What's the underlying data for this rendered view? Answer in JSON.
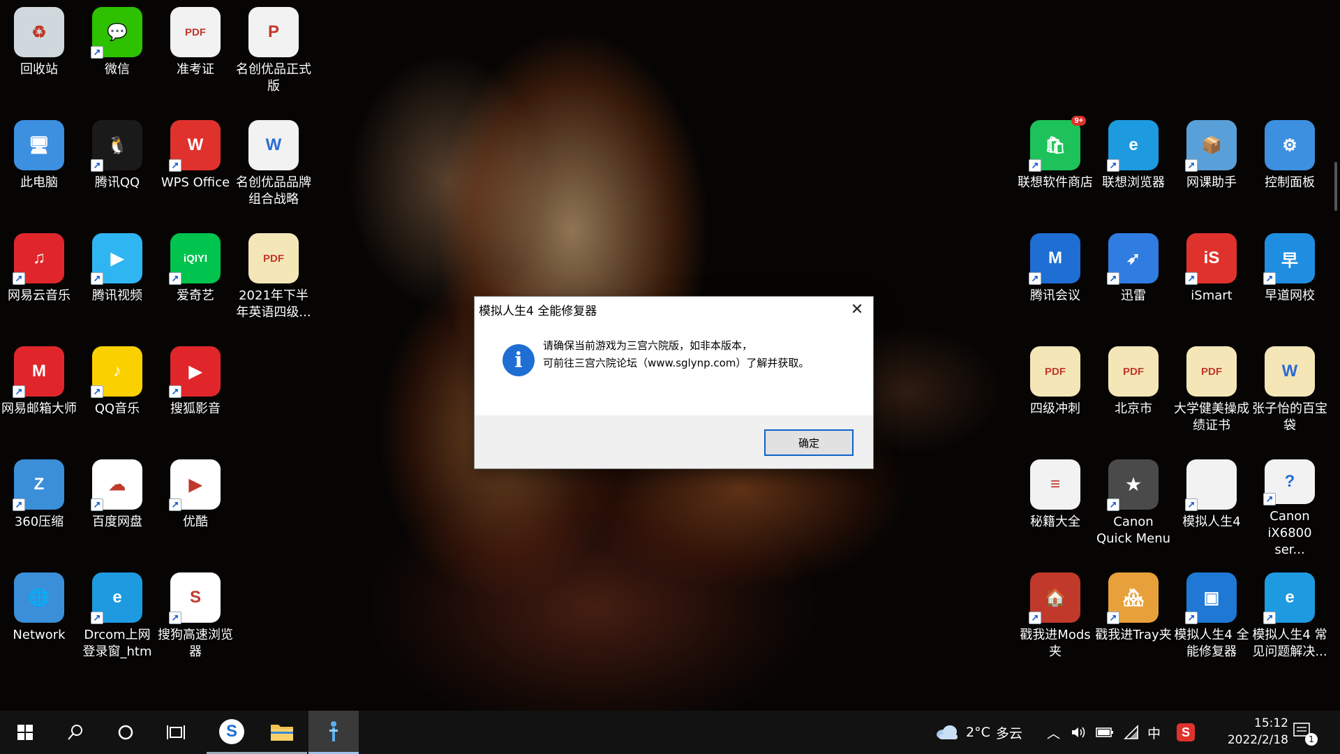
{
  "desktop": {
    "left_icons": [
      {
        "label": "回收站",
        "icon": "recycle-bin-icon",
        "color": "#cfd8dc",
        "glyph": "♻",
        "shortcut": false
      },
      {
        "label": "微信",
        "icon": "wechat-icon",
        "color": "#2dc100",
        "glyph": "💬",
        "shortcut": true
      },
      {
        "label": "准考证",
        "icon": "pdf-file-icon",
        "color": "#f2f2f2",
        "glyph": "PDF",
        "shortcut": false
      },
      {
        "label": "名创优品正式版",
        "icon": "ppt-file-icon",
        "color": "#f2f2f2",
        "glyph": "P",
        "shortcut": false
      },
      {
        "label": "此电脑",
        "icon": "this-pc-icon",
        "color": "#3d8fe0",
        "glyph": "🖥",
        "shortcut": false
      },
      {
        "label": "腾讯QQ",
        "icon": "qq-penguin-icon",
        "color": "#1a1a1a",
        "glyph": "🐧",
        "shortcut": true
      },
      {
        "label": "WPS Office",
        "icon": "wps-office-icon",
        "color": "#e0322d",
        "glyph": "W",
        "shortcut": true
      },
      {
        "label": "名创优品品牌组合战略",
        "icon": "word-file-icon",
        "color": "#f2f2f2",
        "glyph": "W",
        "shortcut": false
      },
      {
        "label": "网易云音乐",
        "icon": "netease-music-icon",
        "color": "#e0262b",
        "glyph": "♫",
        "shortcut": true
      },
      {
        "label": "腾讯视频",
        "icon": "tencent-video-icon",
        "color": "#2fb5f2",
        "glyph": "▶",
        "shortcut": true
      },
      {
        "label": "爱奇艺",
        "icon": "iqiyi-icon",
        "color": "#00c44d",
        "glyph": "iQIYI",
        "shortcut": true
      },
      {
        "label": "2021年下半年英语四级...",
        "icon": "pdf-file-icon",
        "color": "#f5e6b8",
        "glyph": "PDF",
        "shortcut": false
      },
      {
        "label": "网易邮箱大师",
        "icon": "netease-mail-icon",
        "color": "#e0262b",
        "glyph": "M",
        "shortcut": true
      },
      {
        "label": "QQ音乐",
        "icon": "qq-music-icon",
        "color": "#fbd000",
        "glyph": "♪",
        "shortcut": true
      },
      {
        "label": "搜狐影音",
        "icon": "sohu-video-icon",
        "color": "#e0262b",
        "glyph": "▶",
        "shortcut": true
      },
      {
        "label": "",
        "icon": "",
        "color": "",
        "glyph": "",
        "shortcut": false
      },
      {
        "label": "360压缩",
        "icon": "archive-360-icon",
        "color": "#3a8fd8",
        "glyph": "Z",
        "shortcut": true
      },
      {
        "label": "百度网盘",
        "icon": "baidu-netdisk-icon",
        "color": "#ffffff",
        "glyph": "☁",
        "shortcut": true
      },
      {
        "label": "优酷",
        "icon": "youku-icon",
        "color": "#ffffff",
        "glyph": "▶",
        "shortcut": true
      },
      {
        "label": "",
        "icon": "",
        "color": "",
        "glyph": "",
        "shortcut": false
      },
      {
        "label": "Network",
        "icon": "network-globe-icon",
        "color": "#3a8fd8",
        "glyph": "🌐",
        "shortcut": false
      },
      {
        "label": "Drcom上网登录窗_htm",
        "icon": "edge-browser-icon",
        "color": "#1e9ae0",
        "glyph": "e",
        "shortcut": true
      },
      {
        "label": "搜狗高速浏览器",
        "icon": "sogou-browser-icon",
        "color": "#ffffff",
        "glyph": "S",
        "shortcut": true
      }
    ],
    "right_icons": [
      {
        "label": "联想软件商店",
        "icon": "lenovo-store-icon",
        "color": "#1ec25a",
        "glyph": "🛍",
        "shortcut": true,
        "badge": "9+"
      },
      {
        "label": "联想浏览器",
        "icon": "lenovo-browser-icon",
        "color": "#1e9ae0",
        "glyph": "e",
        "shortcut": true
      },
      {
        "label": "网课助手",
        "icon": "online-class-icon",
        "color": "#5aa0d8",
        "glyph": "📦",
        "shortcut": true
      },
      {
        "label": "控制面板",
        "icon": "control-panel-icon",
        "color": "#3d8fe0",
        "glyph": "⚙",
        "shortcut": false
      },
      {
        "label": "腾讯会议",
        "icon": "tencent-meeting-icon",
        "color": "#1f6ed4",
        "glyph": "M",
        "shortcut": true
      },
      {
        "label": "迅雷",
        "icon": "xunlei-icon",
        "color": "#2f7de1",
        "glyph": "➶",
        "shortcut": true
      },
      {
        "label": "iSmart",
        "icon": "ismart-icon",
        "color": "#e0322d",
        "glyph": "iS",
        "shortcut": true
      },
      {
        "label": "早道网校",
        "icon": "zaodao-icon",
        "color": "#1f8ee0",
        "glyph": "早",
        "shortcut": true
      },
      {
        "label": "四级冲刺",
        "icon": "pdf-file-icon",
        "color": "#f5e6b8",
        "glyph": "PDF",
        "shortcut": false
      },
      {
        "label": "北京市",
        "icon": "pdf-file-icon",
        "color": "#f5e6b8",
        "glyph": "PDF",
        "shortcut": false
      },
      {
        "label": "大学健美操成绩证书",
        "icon": "pdf-file-icon",
        "color": "#f5e6b8",
        "glyph": "PDF",
        "shortcut": false
      },
      {
        "label": "张子怡的百宝袋",
        "icon": "word-file-icon",
        "color": "#f5e6b8",
        "glyph": "W",
        "shortcut": false
      },
      {
        "label": "秘籍大全",
        "icon": "text-file-icon",
        "color": "#f2f2f2",
        "glyph": "≡",
        "shortcut": false
      },
      {
        "label": "Canon Quick Menu",
        "icon": "canon-quick-menu-icon",
        "color": "#4a4a4a",
        "glyph": "★",
        "shortcut": true
      },
      {
        "label": "模拟人生4",
        "icon": "blank-file-icon",
        "color": "#f2f2f2",
        "glyph": "",
        "shortcut": true
      },
      {
        "label": "Canon iX6800 ser...",
        "icon": "canon-help-icon",
        "color": "#f2f2f2",
        "glyph": "?",
        "shortcut": true
      },
      {
        "label": "戳我进Mods夹",
        "icon": "mods-folder-icon",
        "color": "#c0392b",
        "glyph": "🏠",
        "shortcut": true
      },
      {
        "label": "戳我进Tray夹",
        "icon": "tray-folder-icon",
        "color": "#e8a13a",
        "glyph": "🏘",
        "shortcut": true
      },
      {
        "label": "模拟人生4 全能修复器",
        "icon": "repair-tool-icon",
        "color": "#1e78d4",
        "glyph": "▣",
        "shortcut": true
      },
      {
        "label": "模拟人生4 常见问题解决...",
        "icon": "edge-browser-icon",
        "color": "#1e9ae0",
        "glyph": "e",
        "shortcut": true
      }
    ]
  },
  "dialog": {
    "title": "模拟人生4 全能修复器",
    "line1": "请确保当前游戏为三宫六院版，如非本版本，",
    "line2": "可前往三宫六院论坛（www.sglynp.com）了解并获取。",
    "ok_label": "确定",
    "info_glyph": "i",
    "close_glyph": "✕"
  },
  "taskbar": {
    "weather_temp": "2°C",
    "weather_desc": "多云",
    "ime": "中",
    "time": "15:12",
    "date": "2022/2/18",
    "notification_count": "1",
    "accent": "#9fc4ec"
  }
}
